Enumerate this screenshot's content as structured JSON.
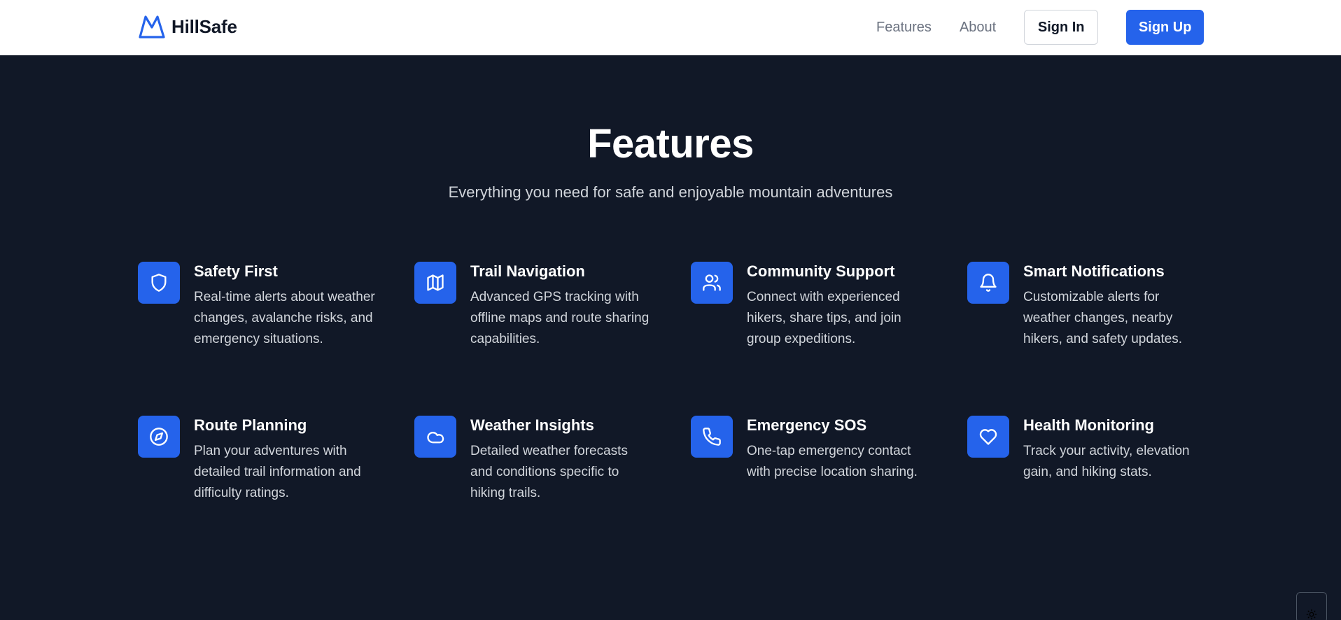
{
  "brand": {
    "name": "HillSafe",
    "icon": "mountain-icon",
    "color": "#2563eb"
  },
  "nav": {
    "links": [
      "Features",
      "About"
    ],
    "sign_in": "Sign In",
    "sign_up": "Sign Up"
  },
  "section": {
    "title": "Features",
    "subtitle": "Everything you need for safe and enjoyable mountain adventures"
  },
  "features": [
    {
      "icon": "shield-icon",
      "title": "Safety First",
      "description": "Real-time alerts about weather changes, avalanche risks, and emergency situations."
    },
    {
      "icon": "map-icon",
      "title": "Trail Navigation",
      "description": "Advanced GPS tracking with offline maps and route sharing capabilities."
    },
    {
      "icon": "users-icon",
      "title": "Community Support",
      "description": "Connect with experienced hikers, share tips, and join group expeditions."
    },
    {
      "icon": "bell-icon",
      "title": "Smart Notifications",
      "description": "Customizable alerts for weather changes, nearby hikers, and safety updates."
    },
    {
      "icon": "compass-icon",
      "title": "Route Planning",
      "description": "Plan your adventures with detailed trail information and difficulty ratings."
    },
    {
      "icon": "cloud-icon",
      "title": "Weather Insights",
      "description": "Detailed weather forecasts and conditions specific to hiking trails."
    },
    {
      "icon": "phone-icon",
      "title": "Emergency SOS",
      "description": "One-tap emergency contact with precise location sharing."
    },
    {
      "icon": "heart-icon",
      "title": "Health Monitoring",
      "description": "Track your activity, elevation gain, and hiking stats."
    }
  ],
  "colors": {
    "accent": "#2563eb",
    "background": "#111827",
    "navbar": "#ffffff"
  },
  "corner_button": {
    "icon": "sun-icon"
  }
}
